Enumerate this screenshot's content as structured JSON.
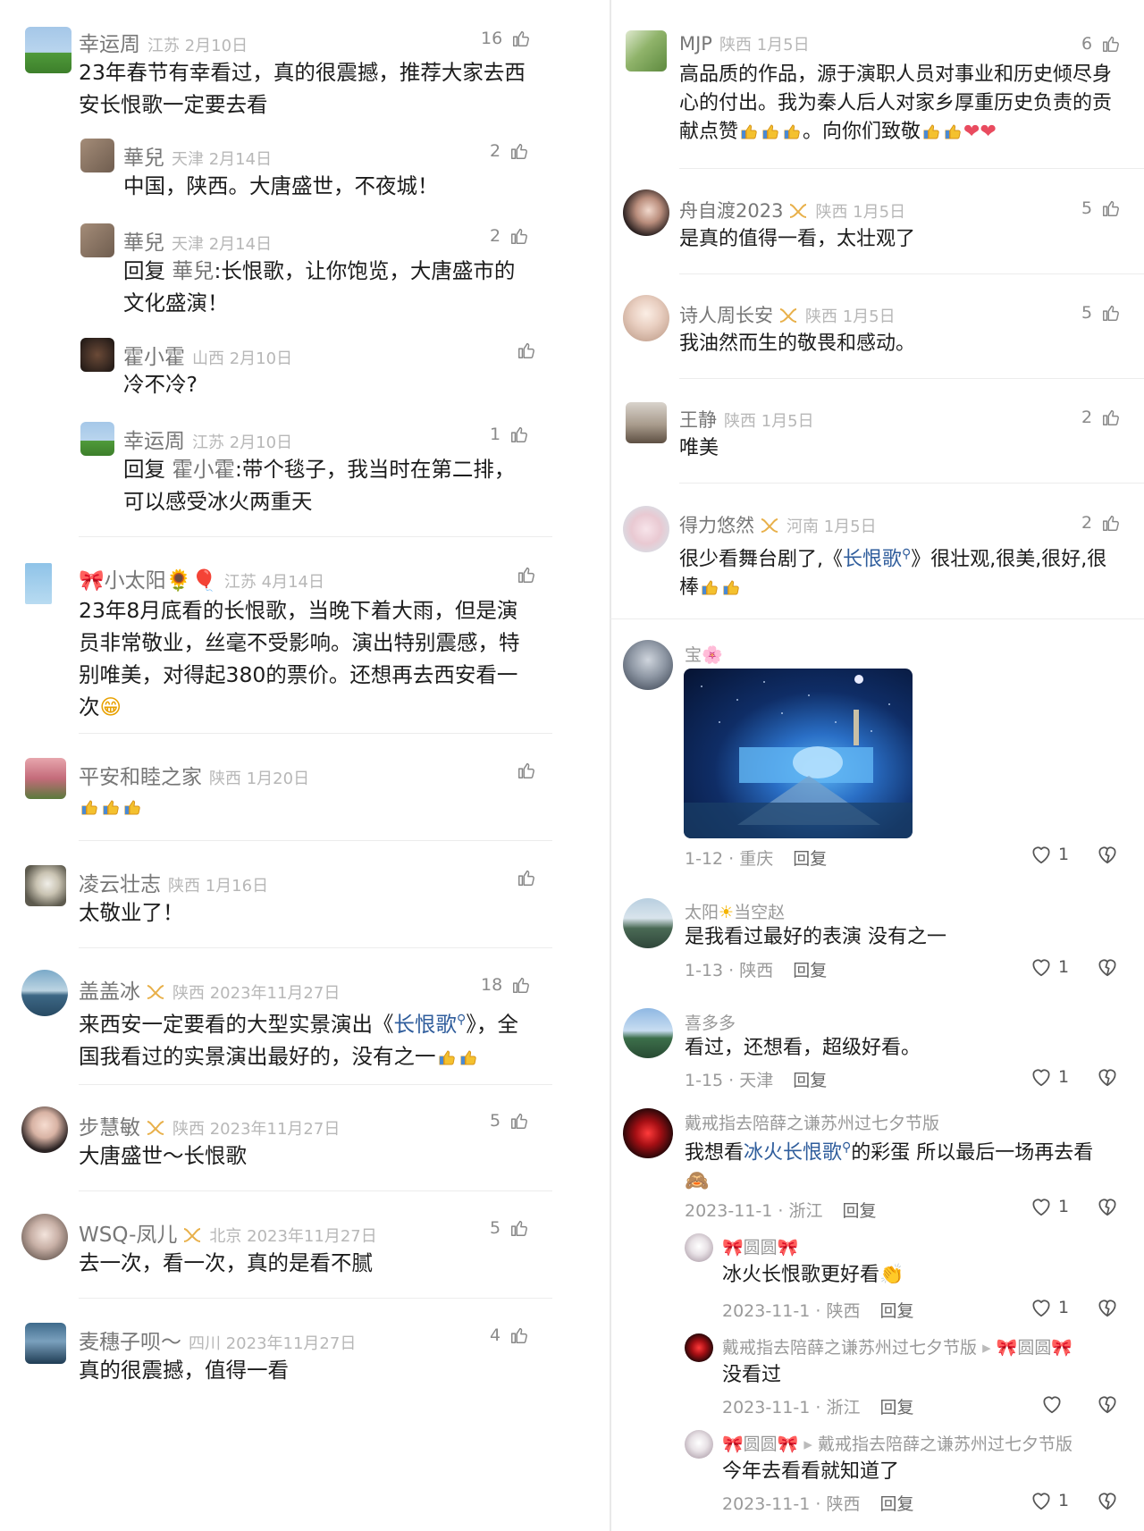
{
  "left_comments": [
    {
      "name": "幸运周",
      "meta": "江苏 2月10日",
      "likes": "16",
      "text": "23年春节有幸看过，真的很震撼，推荐大家去西安长恨歌一定要去看"
    },
    {
      "name": "華兒",
      "meta": "天津 2月14日",
      "likes": "2",
      "text": "中国，陕西。大唐盛世，不夜城！"
    },
    {
      "name": "華兒",
      "meta": "天津 2月14日",
      "likes": "2",
      "reply_prefix": "回复",
      "reply_to": "華兒",
      "text": ":长恨歌，让你饱览，大唐盛市的文化盛演！"
    },
    {
      "name": "霍小霍",
      "meta": "山西 2月10日",
      "likes": "",
      "text": "冷不冷?"
    },
    {
      "name": "幸运周",
      "meta": "江苏 2月10日",
      "likes": "1",
      "reply_prefix": "回复",
      "reply_to": "霍小霍",
      "text": ":带个毯子，我当时在第二排，可以感受冰火两重天"
    },
    {
      "name": "小太阳",
      "meta": "江苏 4月14日",
      "likes": "",
      "text": "23年8月底看的长恨歌，当晚下着大雨，但是演员非常敬业，丝毫不受影响。演出特别震感，特别唯美，对得起380的票价。还想再去西安看一次"
    },
    {
      "name": "平安和睦之家",
      "meta": "陕西 1月20日",
      "likes": "",
      "text": ""
    },
    {
      "name": "凌云壮志",
      "meta": "陕西 1月16日",
      "likes": "",
      "text": "太敬业了！"
    },
    {
      "name": "盖盖冰",
      "meta": "陕西 2023年11月27日",
      "likes": "18",
      "text_a": "来西安一定要看的大型实景演出《",
      "link": "长恨歌",
      "text_b": "》，全国我看过的实景演出最好的，没有之一"
    },
    {
      "name": "步慧敏",
      "meta": "陕西 2023年11月27日",
      "likes": "5",
      "text": "大唐盛世～长恨歌"
    },
    {
      "name": "WSQ-凤儿",
      "meta": "北京 2023年11月27日",
      "likes": "5",
      "text": "去一次，看一次，真的是看不腻"
    },
    {
      "name": "麦穗子呗～",
      "meta": "四川 2023年11月27日",
      "likes": "4",
      "text": "真的很震撼，值得一看"
    }
  ],
  "right_comments": [
    {
      "name": "MJP",
      "meta": "陕西 1月5日",
      "likes": "6",
      "text": "高品质的作品，源于演职人员对事业和历史倾尽身心的付出。我为秦人后人对家乡厚重历史负责的贡献点赞",
      "text_b": "。向你们致敬"
    },
    {
      "name": "舟自渡2023",
      "meta": "陕西 1月5日",
      "likes": "5",
      "text": "是真的值得一看，太壮观了"
    },
    {
      "name": "诗人周长安",
      "meta": "陕西 1月5日",
      "likes": "5",
      "text": "我油然而生的敬畏和感动。"
    },
    {
      "name": "王静",
      "meta": "陕西 1月5日",
      "likes": "2",
      "text": "唯美"
    },
    {
      "name": "得力悠然",
      "meta": "河南 1月5日",
      "likes": "2",
      "text_a": "很少看舞台剧了,《",
      "link": "长恨歌",
      "text_b": "》很壮观,很美,很好,很棒"
    }
  ],
  "thread": [
    {
      "name": "宝",
      "date": "1-12 · 重庆",
      "reply": "回复",
      "hearts": "1",
      "text": ""
    },
    {
      "name_a": "太阳",
      "name_b": "当空赵",
      "date": "1-13 · 陕西",
      "reply": "回复",
      "hearts": "1",
      "text": "是我看过最好的表演 没有之一"
    },
    {
      "name": "喜多多",
      "date": "1-15 · 天津",
      "reply": "回复",
      "hearts": "1",
      "text": "看过，还想看，超级好看。"
    },
    {
      "name": "戴戒指去陪薛之谦苏州过七夕节版",
      "date": "2023-11-1 · 浙江",
      "reply": "回复",
      "hearts": "1",
      "text_a": "我想看",
      "link": "冰火长恨歌",
      "text_b": "的彩蛋  所以最后一场再去看"
    },
    {
      "name": "圆圆",
      "date": "2023-11-1 · 陕西",
      "reply": "回复",
      "hearts": "1",
      "text": "冰火长恨歌更好看"
    },
    {
      "name": "戴戒指去陪薛之谦苏州过七夕节版",
      "to": "圆圆",
      "date": "2023-11-1 · 浙江",
      "reply": "回复",
      "hearts": "",
      "text": "没看过"
    },
    {
      "name": "圆圆",
      "to": "戴戒指去陪薛之谦苏州过七夕节版",
      "date": "2023-11-1 · 陕西",
      "reply": "回复",
      "hearts": "1",
      "text": "今年去看看就知道了"
    }
  ]
}
